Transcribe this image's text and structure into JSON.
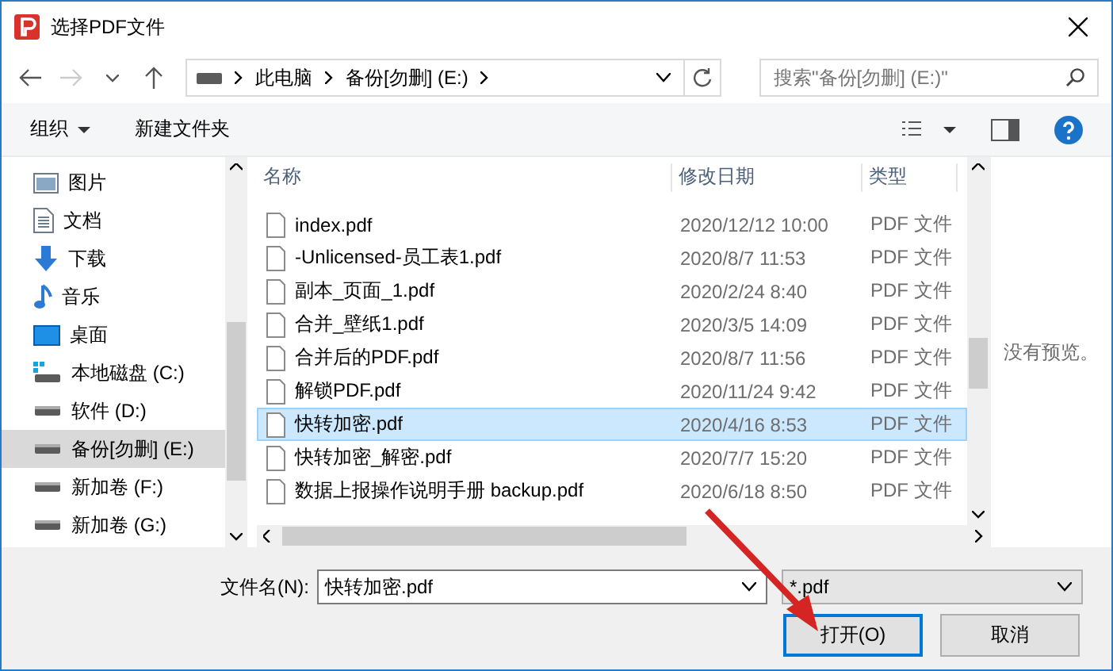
{
  "window": {
    "title": "选择PDF文件"
  },
  "address_bar": {
    "segments": [
      "此电脑",
      "备份[勿删] (E:)"
    ]
  },
  "search": {
    "placeholder": "搜索\"备份[勿删] (E:)\""
  },
  "toolbar": {
    "organize": "组织",
    "new_folder": "新建文件夹"
  },
  "sidebar": {
    "items": [
      {
        "label": "图片",
        "kind": "pictures",
        "selected": false
      },
      {
        "label": "文档",
        "kind": "documents",
        "selected": false
      },
      {
        "label": "下载",
        "kind": "downloads",
        "selected": false
      },
      {
        "label": "音乐",
        "kind": "music",
        "selected": false
      },
      {
        "label": "桌面",
        "kind": "desktop",
        "selected": false
      },
      {
        "label": "本地磁盘 (C:)",
        "kind": "system_drive",
        "selected": false
      },
      {
        "label": "软件 (D:)",
        "kind": "drive",
        "selected": false
      },
      {
        "label": "备份[勿删] (E:)",
        "kind": "drive",
        "selected": true
      },
      {
        "label": "新加卷 (F:)",
        "kind": "drive",
        "selected": false
      },
      {
        "label": "新加卷 (G:)",
        "kind": "drive",
        "selected": false
      }
    ]
  },
  "file_list": {
    "columns": [
      "名称",
      "修改日期",
      "类型"
    ],
    "rows": [
      {
        "name": "index.pdf",
        "modified": "2020/12/12 10:00",
        "type": "PDF 文件",
        "selected": false
      },
      {
        "name": "-Unlicensed-员工表1.pdf",
        "modified": "2020/8/7 11:53",
        "type": "PDF 文件",
        "selected": false
      },
      {
        "name": "副本_页面_1.pdf",
        "modified": "2020/2/24 8:40",
        "type": "PDF 文件",
        "selected": false
      },
      {
        "name": "合并_壁纸1.pdf",
        "modified": "2020/3/5 14:09",
        "type": "PDF 文件",
        "selected": false
      },
      {
        "name": "合并后的PDF.pdf",
        "modified": "2020/8/7 11:56",
        "type": "PDF 文件",
        "selected": false
      },
      {
        "name": "解锁PDF.pdf",
        "modified": "2020/11/24 9:42",
        "type": "PDF 文件",
        "selected": false
      },
      {
        "name": "快转加密.pdf",
        "modified": "2020/4/16 8:53",
        "type": "PDF 文件",
        "selected": true
      },
      {
        "name": "快转加密_解密.pdf",
        "modified": "2020/7/7 15:20",
        "type": "PDF 文件",
        "selected": false
      },
      {
        "name": "数据上报操作说明手册 backup.pdf",
        "modified": "2020/6/18 8:50",
        "type": "PDF 文件",
        "selected": false
      }
    ]
  },
  "preview": {
    "message": "没有预览。"
  },
  "file_name": {
    "label": "文件名(N):",
    "value": "快转加密.pdf"
  },
  "file_type": {
    "value": "*.pdf"
  },
  "buttons": [
    {
      "label": "打开(O)",
      "kind": "primary"
    },
    {
      "label": "取消",
      "kind": "normal"
    }
  ]
}
